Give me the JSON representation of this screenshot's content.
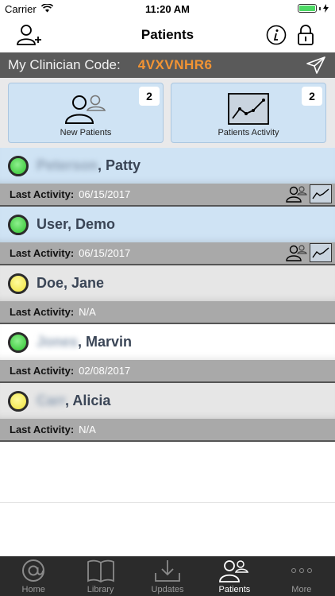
{
  "status_bar": {
    "carrier": "Carrier",
    "time": "11:20 AM"
  },
  "nav": {
    "title": "Patients",
    "add_patient_icon": "add-user-icon",
    "info_icon": "info-icon",
    "lock_icon": "lock-icon"
  },
  "code_bar": {
    "label": "My Clinician Code:",
    "code": "4VXVNHR6",
    "send_icon": "send-icon",
    "code_color": "#f39433"
  },
  "tiles": [
    {
      "label": "New Patients",
      "badge": "2",
      "icon": "users-icon"
    },
    {
      "label": "Patients Activity",
      "badge": "2",
      "icon": "line-chart-icon"
    }
  ],
  "patients": [
    {
      "hidden_last": "Peterson",
      "visible": ", Patty",
      "status": "green",
      "row_bg": "blue",
      "activity_label": "Last Activity:",
      "activity": "06/15/2017",
      "icons": true
    },
    {
      "hidden_last": "",
      "visible": "User, Demo",
      "status": "green",
      "row_bg": "blue",
      "activity_label": "Last Activity:",
      "activity": "06/15/2017",
      "icons": true
    },
    {
      "hidden_last": "",
      "visible": "Doe, Jane",
      "status": "yellow",
      "row_bg": "gray",
      "activity_label": "Last Activity:",
      "activity": "N/A",
      "icons": false
    },
    {
      "hidden_last": "Jones",
      "visible": ", Marvin",
      "status": "green",
      "row_bg": "white",
      "activity_label": "Last Activity:",
      "activity": "02/08/2017",
      "icons": false
    },
    {
      "hidden_last": "Carr",
      "visible": ", Alicia",
      "status": "yellow",
      "row_bg": "gray",
      "activity_label": "Last Activity:",
      "activity": "N/A",
      "icons": false
    }
  ],
  "tab_bar": {
    "tabs": [
      {
        "label": "Home",
        "icon": "at-icon",
        "active": false
      },
      {
        "label": "Library",
        "icon": "book-icon",
        "active": false
      },
      {
        "label": "Updates",
        "icon": "download-icon",
        "active": false
      },
      {
        "label": "Patients",
        "icon": "users-icon",
        "active": true
      },
      {
        "label": "More",
        "icon": "more-icon",
        "active": false
      }
    ]
  }
}
